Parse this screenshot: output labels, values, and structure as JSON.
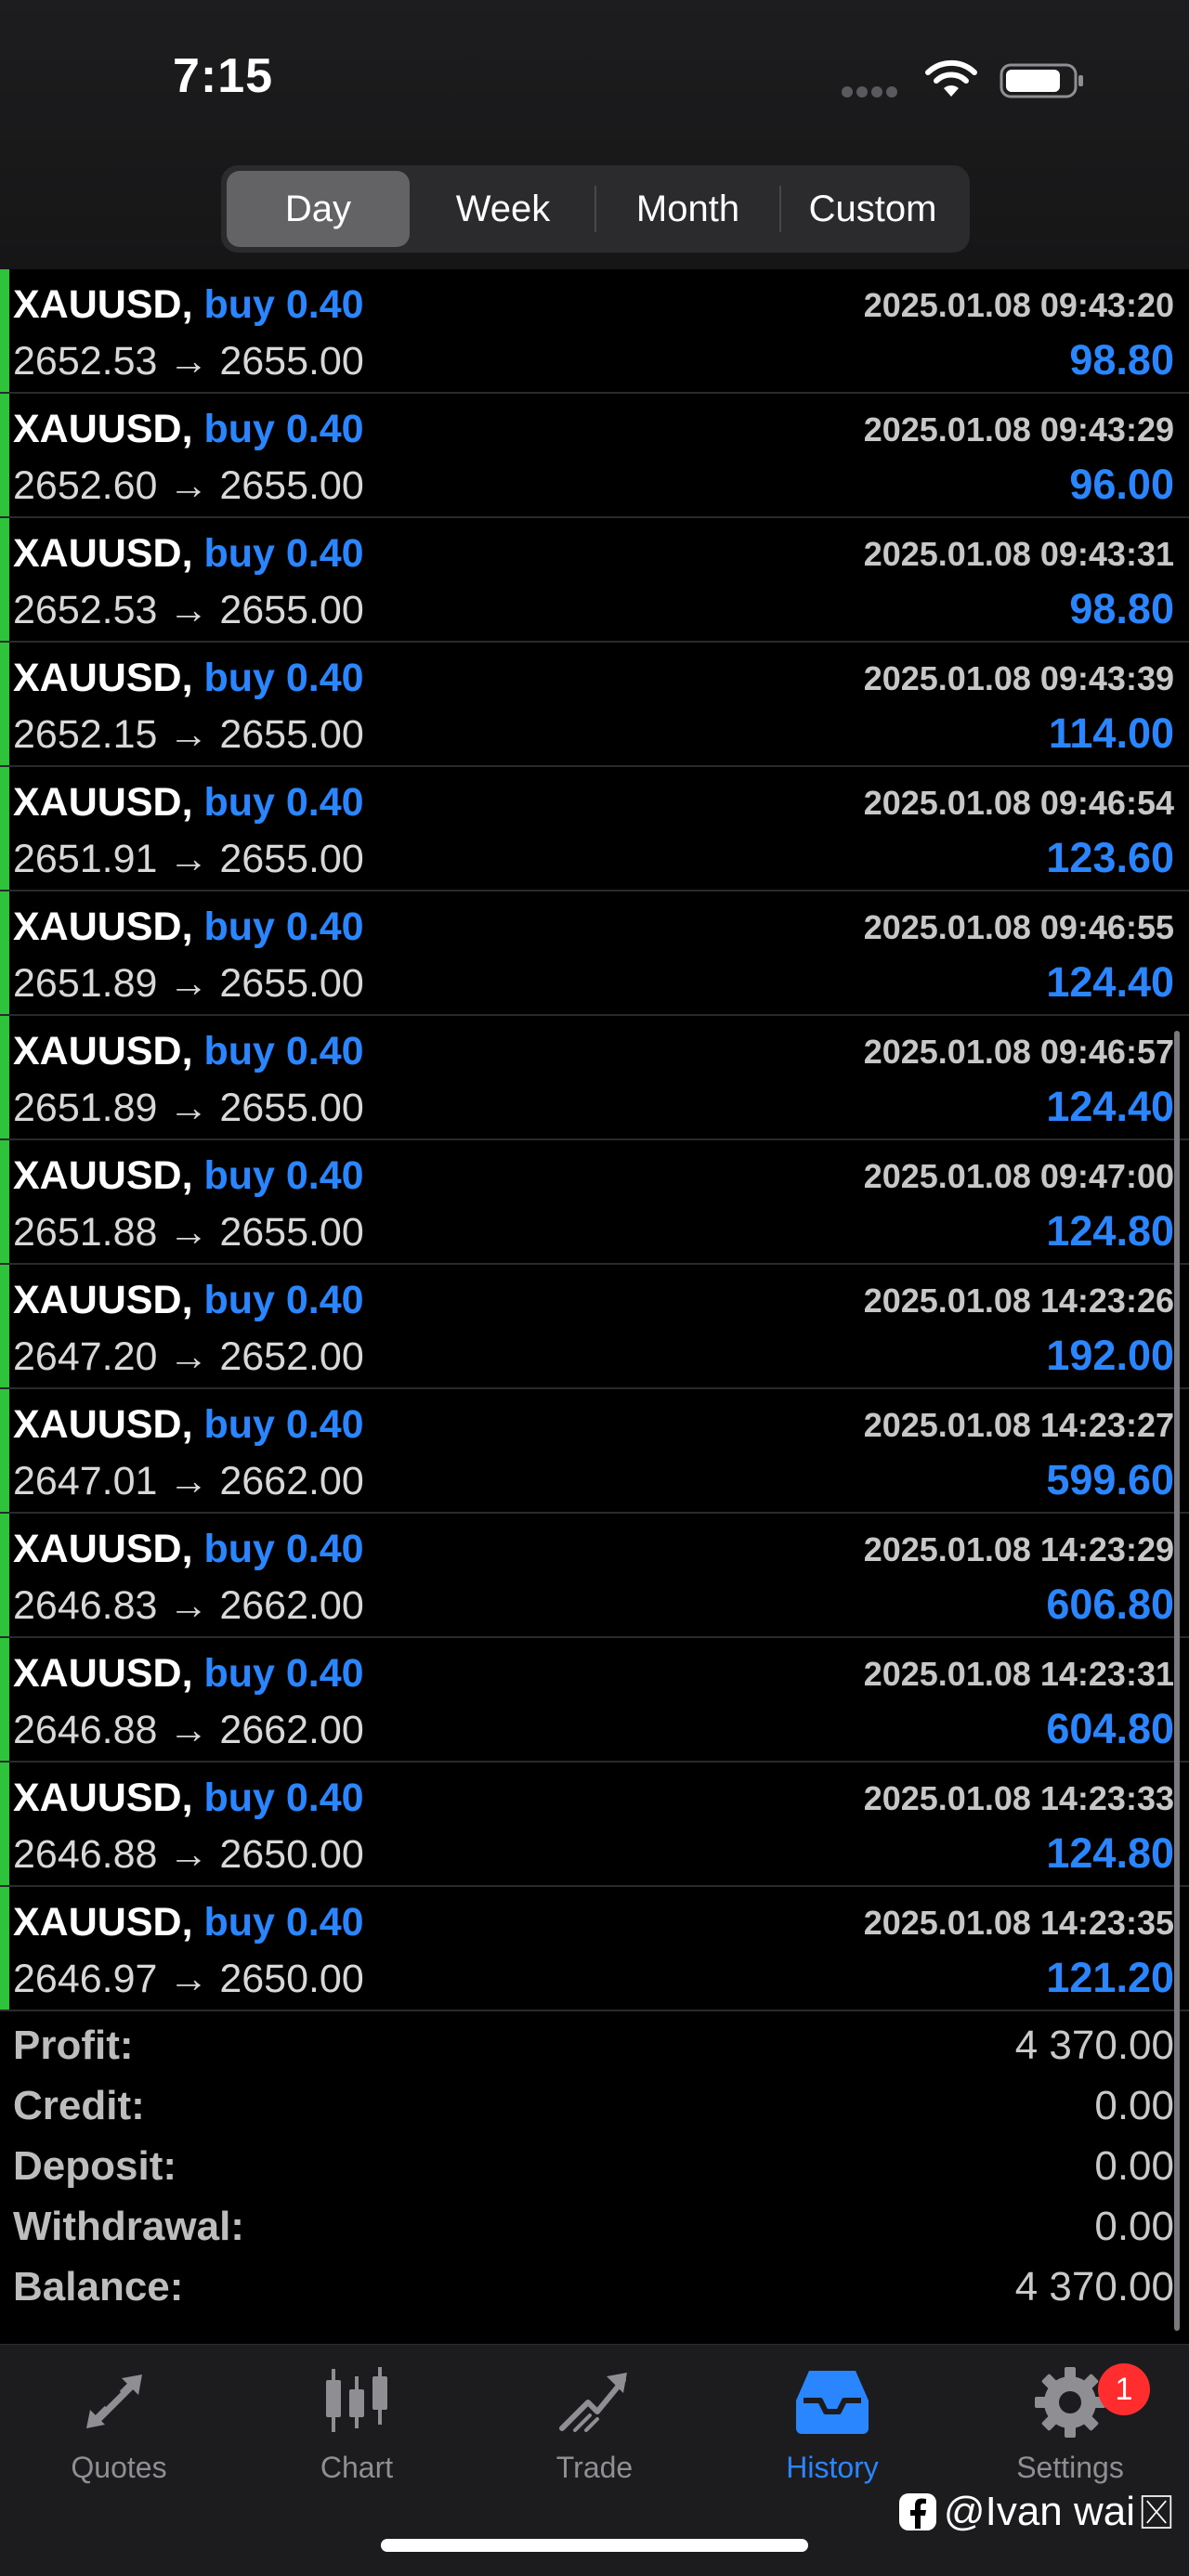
{
  "status_bar": {
    "time": "7:15"
  },
  "periods": [
    "Day",
    "Week",
    "Month",
    "Custom"
  ],
  "trades": [
    {
      "symbol": "XAUUSD,",
      "side": "buy 0.40",
      "prices": "2652.53 → 2655.00",
      "time": "2025.01.08 09:43:20",
      "profit": "98.80"
    },
    {
      "symbol": "XAUUSD,",
      "side": "buy 0.40",
      "prices": "2652.60 → 2655.00",
      "time": "2025.01.08 09:43:29",
      "profit": "96.00"
    },
    {
      "symbol": "XAUUSD,",
      "side": "buy 0.40",
      "prices": "2652.53 → 2655.00",
      "time": "2025.01.08 09:43:31",
      "profit": "98.80"
    },
    {
      "symbol": "XAUUSD,",
      "side": "buy 0.40",
      "prices": "2652.15 → 2655.00",
      "time": "2025.01.08 09:43:39",
      "profit": "114.00"
    },
    {
      "symbol": "XAUUSD,",
      "side": "buy 0.40",
      "prices": "2651.91 → 2655.00",
      "time": "2025.01.08 09:46:54",
      "profit": "123.60"
    },
    {
      "symbol": "XAUUSD,",
      "side": "buy 0.40",
      "prices": "2651.89 → 2655.00",
      "time": "2025.01.08 09:46:55",
      "profit": "124.40"
    },
    {
      "symbol": "XAUUSD,",
      "side": "buy 0.40",
      "prices": "2651.89 → 2655.00",
      "time": "2025.01.08 09:46:57",
      "profit": "124.40"
    },
    {
      "symbol": "XAUUSD,",
      "side": "buy 0.40",
      "prices": "2651.88 → 2655.00",
      "time": "2025.01.08 09:47:00",
      "profit": "124.80"
    },
    {
      "symbol": "XAUUSD,",
      "side": "buy 0.40",
      "prices": "2647.20 → 2652.00",
      "time": "2025.01.08 14:23:26",
      "profit": "192.00"
    },
    {
      "symbol": "XAUUSD,",
      "side": "buy 0.40",
      "prices": "2647.01 → 2662.00",
      "time": "2025.01.08 14:23:27",
      "profit": "599.60"
    },
    {
      "symbol": "XAUUSD,",
      "side": "buy 0.40",
      "prices": "2646.83 → 2662.00",
      "time": "2025.01.08 14:23:29",
      "profit": "606.80"
    },
    {
      "symbol": "XAUUSD,",
      "side": "buy 0.40",
      "prices": "2646.88 → 2662.00",
      "time": "2025.01.08 14:23:31",
      "profit": "604.80"
    },
    {
      "symbol": "XAUUSD,",
      "side": "buy 0.40",
      "prices": "2646.88 → 2650.00",
      "time": "2025.01.08 14:23:33",
      "profit": "124.80"
    },
    {
      "symbol": "XAUUSD,",
      "side": "buy 0.40",
      "prices": "2646.97 → 2650.00",
      "time": "2025.01.08 14:23:35",
      "profit": "121.20"
    }
  ],
  "summary": [
    {
      "label": "Profit:",
      "value": "4 370.00"
    },
    {
      "label": "Credit:",
      "value": "0.00"
    },
    {
      "label": "Deposit:",
      "value": "0.00"
    },
    {
      "label": "Withdrawal:",
      "value": "0.00"
    },
    {
      "label": "Balance:",
      "value": "4 370.00"
    }
  ],
  "tabs": [
    {
      "label": "Quotes",
      "icon": "quotes-icon"
    },
    {
      "label": "Chart",
      "icon": "chart-icon"
    },
    {
      "label": "Trade",
      "icon": "trade-icon"
    },
    {
      "label": "History",
      "icon": "history-icon"
    },
    {
      "label": "Settings",
      "icon": "settings-icon",
      "badge": "1"
    }
  ],
  "watermark": "@Ivan wai",
  "colors": {
    "accent": "#2a86ff",
    "buy_marker": "#2fc23b",
    "badge": "#ff2d2d"
  }
}
